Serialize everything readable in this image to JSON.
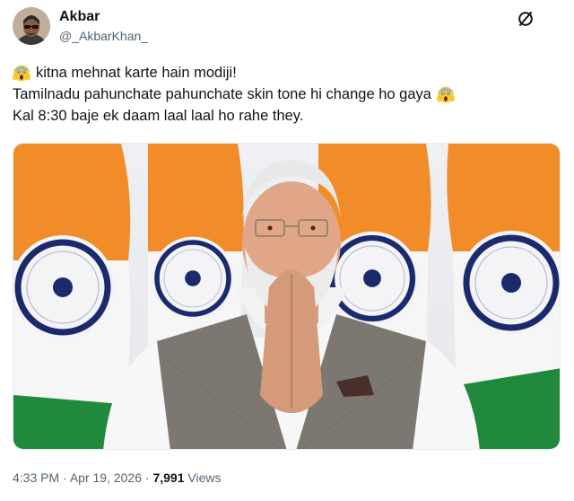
{
  "author": {
    "name": "Akbar",
    "handle": "@_AkbarKhan_"
  },
  "tweet": {
    "lines": [
      {
        "emoji_before": "face-screaming-in-fear",
        "text": "kitna mehnat karte hain modiji!"
      },
      {
        "text": "Tamilnadu pahunchate pahunchate skin tone hi change ho gaya",
        "emoji_after": "face-screaming-in-fear"
      },
      {
        "text": "Kal 8:30 baje ek daam laal laal ho rahe they."
      }
    ]
  },
  "media": {
    "icon": "photo"
  },
  "footer": {
    "time": "4:33 PM",
    "separator": "·",
    "date": "Apr 19, 2026",
    "views_count": "7,991",
    "views_label": "Views"
  },
  "colors": {
    "text_primary": "#0f1419",
    "text_secondary": "#536471",
    "saffron": "#f28c28",
    "flag_green": "#1f8a3b",
    "chakra_navy": "#1a2a6c"
  }
}
